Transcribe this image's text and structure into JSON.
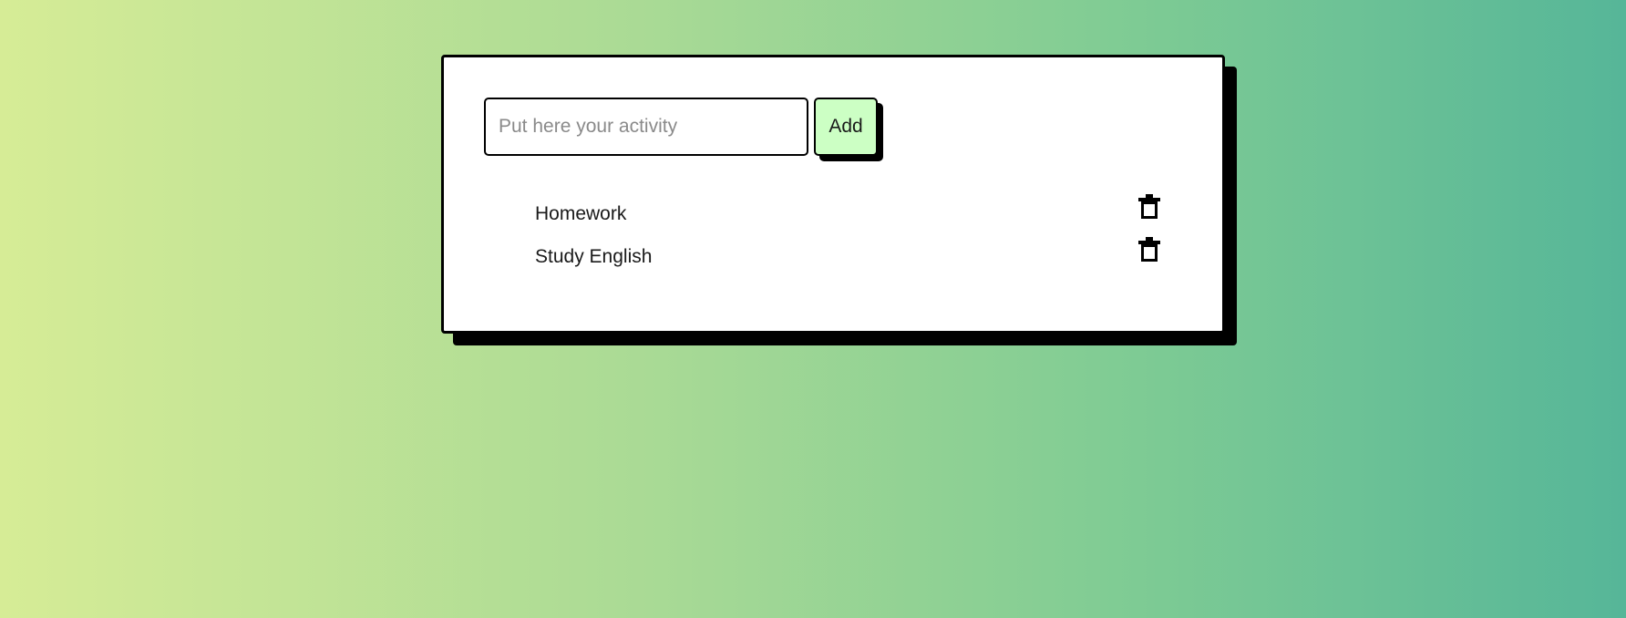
{
  "form": {
    "input_placeholder": "Put here your activity",
    "input_value": "",
    "add_label": "Add"
  },
  "todos": [
    {
      "label": "Homework",
      "delete_icon": "trash-icon"
    },
    {
      "label": "Study English",
      "delete_icon": "trash-icon"
    }
  ],
  "colors": {
    "background_gradient": [
      "#d6ec96",
      "#56b698"
    ],
    "add_button": "#ccffc4",
    "card": "#ffffff",
    "border": "#000000"
  }
}
